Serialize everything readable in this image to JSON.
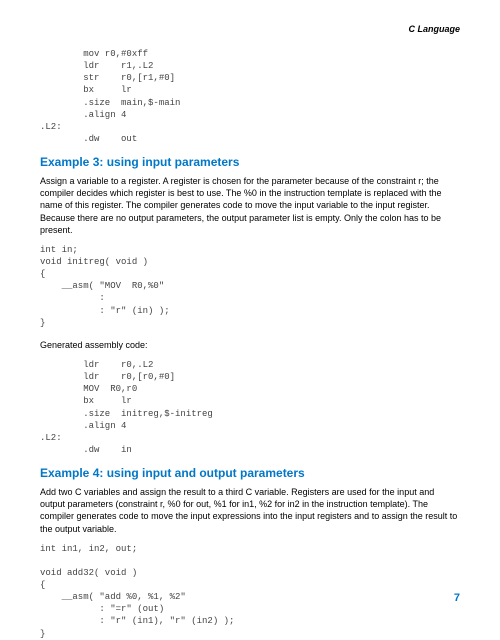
{
  "header": {
    "title": "C Language"
  },
  "code1": "        mov r0,#0xff\n        ldr    r1,.L2\n        str    r0,[r1,#0]\n        bx     lr\n        .size  main,$-main\n        .align 4\n.L2:\n        .dw    out",
  "example3": {
    "heading": "Example 3: using input parameters",
    "para": "Assign a variable to a register. A register is chosen for the parameter because of the constraint r; the compiler decides which register is best to use. The %0 in the instruction template is replaced with the name of this register. The compiler generates code to move the input variable to the input register. Because there are no output parameters, the output parameter list is empty. Only the colon has to be present.",
    "code_c": "int in;\nvoid initreg( void )\n{\n    __asm( \"MOV  R0,%0\"\n           :\n           : \"r\" (in) );\n}",
    "gen_label": "Generated assembly code:",
    "code_asm": "        ldr    r0,.L2\n        ldr    r0,[r0,#0]\n        MOV  R0,r0\n        bx     lr\n        .size  initreg,$-initreg\n        .align 4\n.L2:\n        .dw    in"
  },
  "example4": {
    "heading": "Example 4: using input and output parameters",
    "para": "Add two C variables and assign the result to a third C variable. Registers are used for the input and output parameters (constraint r, %0 for out, %1 for in1, %2 for in2 in the instruction template). The compiler generates code to move the input expressions into the input registers and to assign the result to the output variable.",
    "code_c": "int in1, in2, out;\n\nvoid add32( void )\n{\n    __asm( \"add %0, %1, %2\"\n           : \"=r\" (out)\n           : \"r\" (in1), \"r\" (in2) );\n}"
  },
  "page_number": "7"
}
